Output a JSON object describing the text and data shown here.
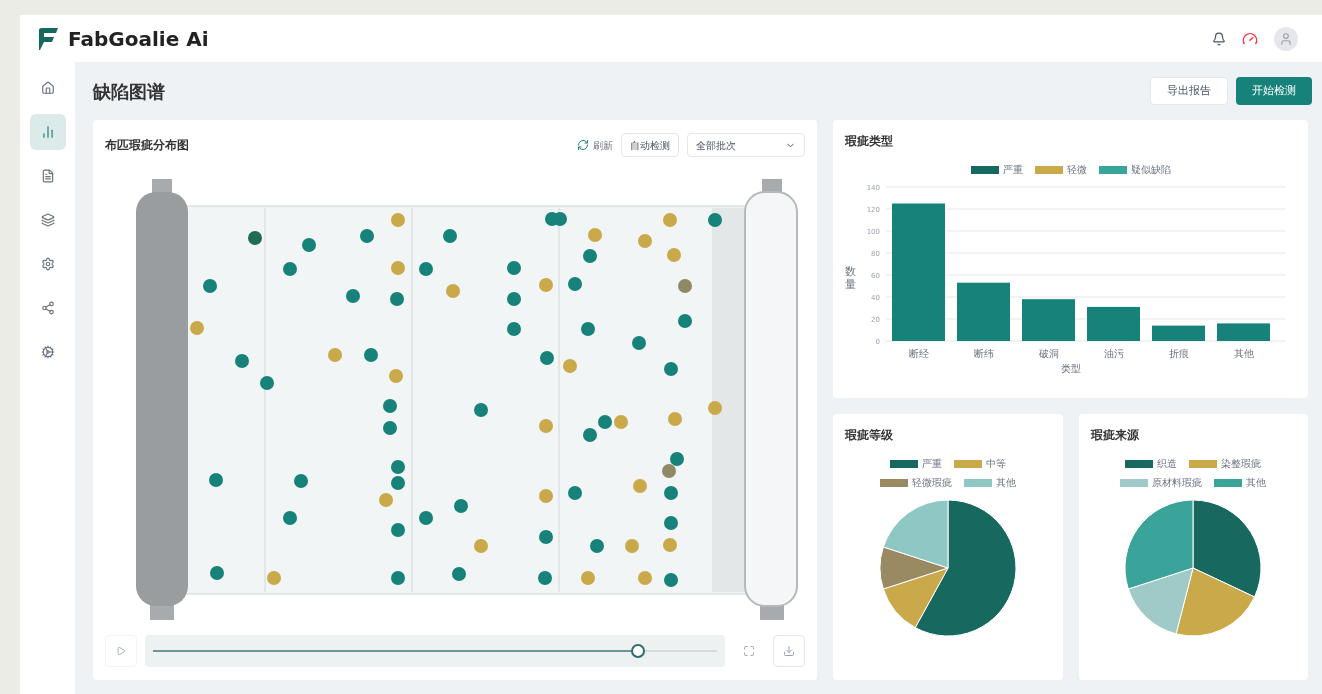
{
  "app": {
    "name": "FabGoalie Ai"
  },
  "sidebar": {
    "items": [
      {
        "selected": false
      },
      {
        "selected": true
      },
      {
        "selected": false
      },
      {
        "selected": false
      },
      {
        "selected": false
      },
      {
        "selected": false
      },
      {
        "selected": false
      }
    ]
  },
  "page": {
    "title": "缺陷图谱",
    "buttons": [
      {
        "label": "导出报告",
        "kind": "secondary"
      },
      {
        "label": "开始检测",
        "kind": "primary"
      }
    ]
  },
  "map_panel": {
    "title": "布匹瑕疵分布图",
    "refresh": "刷新",
    "auto": "自动检测",
    "select": {
      "value": "全部批次"
    },
    "timeline": {
      "level": 0.86
    }
  },
  "bar_panel": {
    "title": "瑕疵类型",
    "legend": [
      {
        "label": "严重",
        "color": "#17685f"
      },
      {
        "label": "轻微",
        "color": "#c9a94a"
      },
      {
        "label": "疑似缺陷",
        "color": "#3aa39a"
      }
    ],
    "chart_data": {
      "type": "bar",
      "xlabel": "类型",
      "ylabel": "数量",
      "categories": [
        "断经",
        "断纬",
        "破洞",
        "油污",
        "折痕",
        "其他"
      ],
      "series": [
        {
          "color": "#17827a",
          "values": [
            125,
            53,
            38,
            31,
            14,
            16
          ]
        }
      ],
      "grid": true,
      "ylim": [
        0,
        140
      ],
      "yticks": [
        0,
        20,
        40,
        60,
        80,
        100,
        120,
        140
      ]
    }
  },
  "pies": [
    {
      "title": "瑕疵等级",
      "legend": [
        {
          "color": "#17685f"
        },
        {
          "color": "#c9a94a"
        },
        {
          "color": "#9a8a62"
        },
        {
          "color": "#8fc7c4"
        }
      ],
      "chart_data": {
        "type": "pie",
        "categories": [
          "严重",
          "中等",
          "轻微瑕疵",
          "其他"
        ],
        "values": [
          58,
          12,
          10,
          20
        ]
      }
    },
    {
      "title": "瑕疵来源",
      "legend": [
        {
          "color": "#17685f"
        },
        {
          "color": "#c9a94a"
        },
        {
          "color": "#9fcac8"
        },
        {
          "color": "#3aa39a"
        }
      ],
      "chart_data": {
        "type": "pie",
        "categories": [
          "织造",
          "染整瑕疵",
          "原材料瑕疵",
          "其他"
        ],
        "values": [
          32,
          22,
          16,
          30
        ]
      }
    }
  ]
}
